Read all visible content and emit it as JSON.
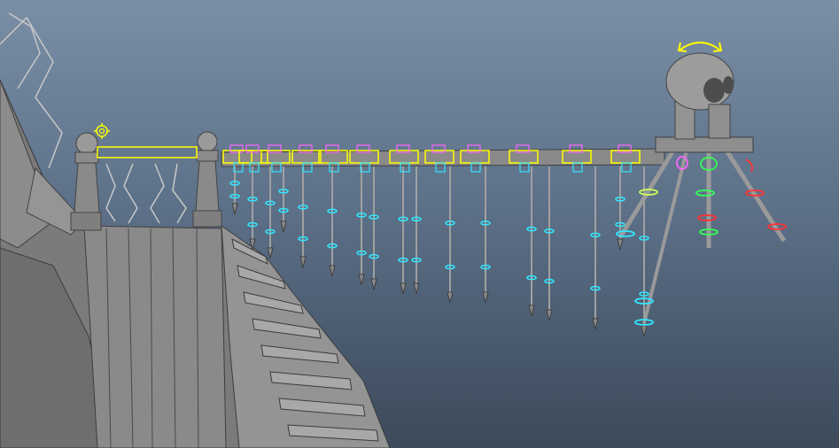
{
  "viewport": {
    "background_top": "#7a8ea5",
    "background_bottom": "#3c4a5a"
  },
  "scene": {
    "objects": [
      {
        "name": "cliff-stairs",
        "type": "mesh"
      },
      {
        "name": "rail-posts",
        "type": "mesh"
      },
      {
        "name": "rope-bridge",
        "type": "mesh"
      },
      {
        "name": "skull-totem",
        "type": "mesh"
      }
    ],
    "hanging_spikes": 17,
    "controller_colors": {
      "selected": "#ffff00",
      "fk": "#33e6ff",
      "ik": "#ff66ff",
      "left": "#ff3333",
      "right": "#33ff55",
      "center": "#ffff44"
    },
    "icons": [
      "rotate-arrow-icon",
      "locator-gear-icon"
    ]
  }
}
